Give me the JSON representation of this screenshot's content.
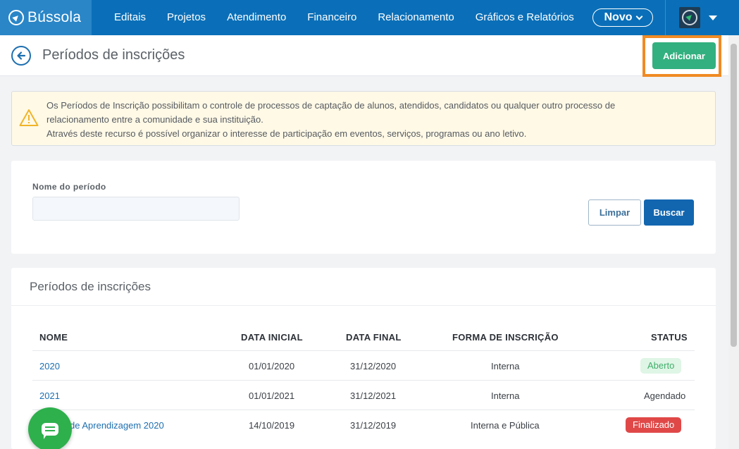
{
  "brand": {
    "name": "Bússola"
  },
  "nav": {
    "items": [
      "Editais",
      "Projetos",
      "Atendimento",
      "Financeiro",
      "Relacionamento",
      "Gráficos e Relatórios"
    ],
    "novo_label": "Novo"
  },
  "header": {
    "title": "Períodos de inscrições",
    "add_label": "Adicionar"
  },
  "info": {
    "line1": "Os Períodos de Inscrição possibilitam o controle de processos de captação de alunos, atendidos, candidatos ou qualquer outro processo de",
    "line2": "relacionamento entre a comunidade e sua instituição.",
    "line3": "Através deste recurso é possível organizar o interesse de participação em eventos, serviços, programas ou ano letivo."
  },
  "search": {
    "field_label": "Nome do período",
    "field_value": "",
    "clear_label": "Limpar",
    "search_label": "Buscar"
  },
  "table": {
    "title": "Períodos de inscrições",
    "headers": {
      "nome": "NOME",
      "data_inicial": "DATA INICIAL",
      "data_final": "DATA FINAL",
      "forma": "FORMA DE INSCRIÇÃO",
      "status": "STATUS"
    },
    "rows": [
      {
        "nome": "2020",
        "data_inicial": "01/01/2020",
        "data_final": "31/12/2020",
        "forma": "Interna",
        "status": "Aberto"
      },
      {
        "nome": "2021",
        "data_inicial": "01/01/2021",
        "data_final": "31/12/2021",
        "forma": "Interna",
        "status": "Agendado"
      },
      {
        "nome": "de Aprendizagem 2020",
        "data_inicial": "14/10/2019",
        "data_final": "31/12/2019",
        "forma": "Interna e Pública",
        "status": "Finalizado"
      }
    ]
  },
  "colors": {
    "nav_bg": "#0a6fb8",
    "add_button": "#33b07f",
    "highlight": "#f08a24",
    "search_button": "#1266b0",
    "status_open": "#3fae6a",
    "status_finished": "#e04848",
    "chat_fab": "#2eb04d"
  },
  "icons": [
    "compass-logo-icon",
    "chevron-down-icon",
    "caret-down-icon",
    "back-arrow-icon",
    "warning-icon",
    "chat-icon"
  ]
}
